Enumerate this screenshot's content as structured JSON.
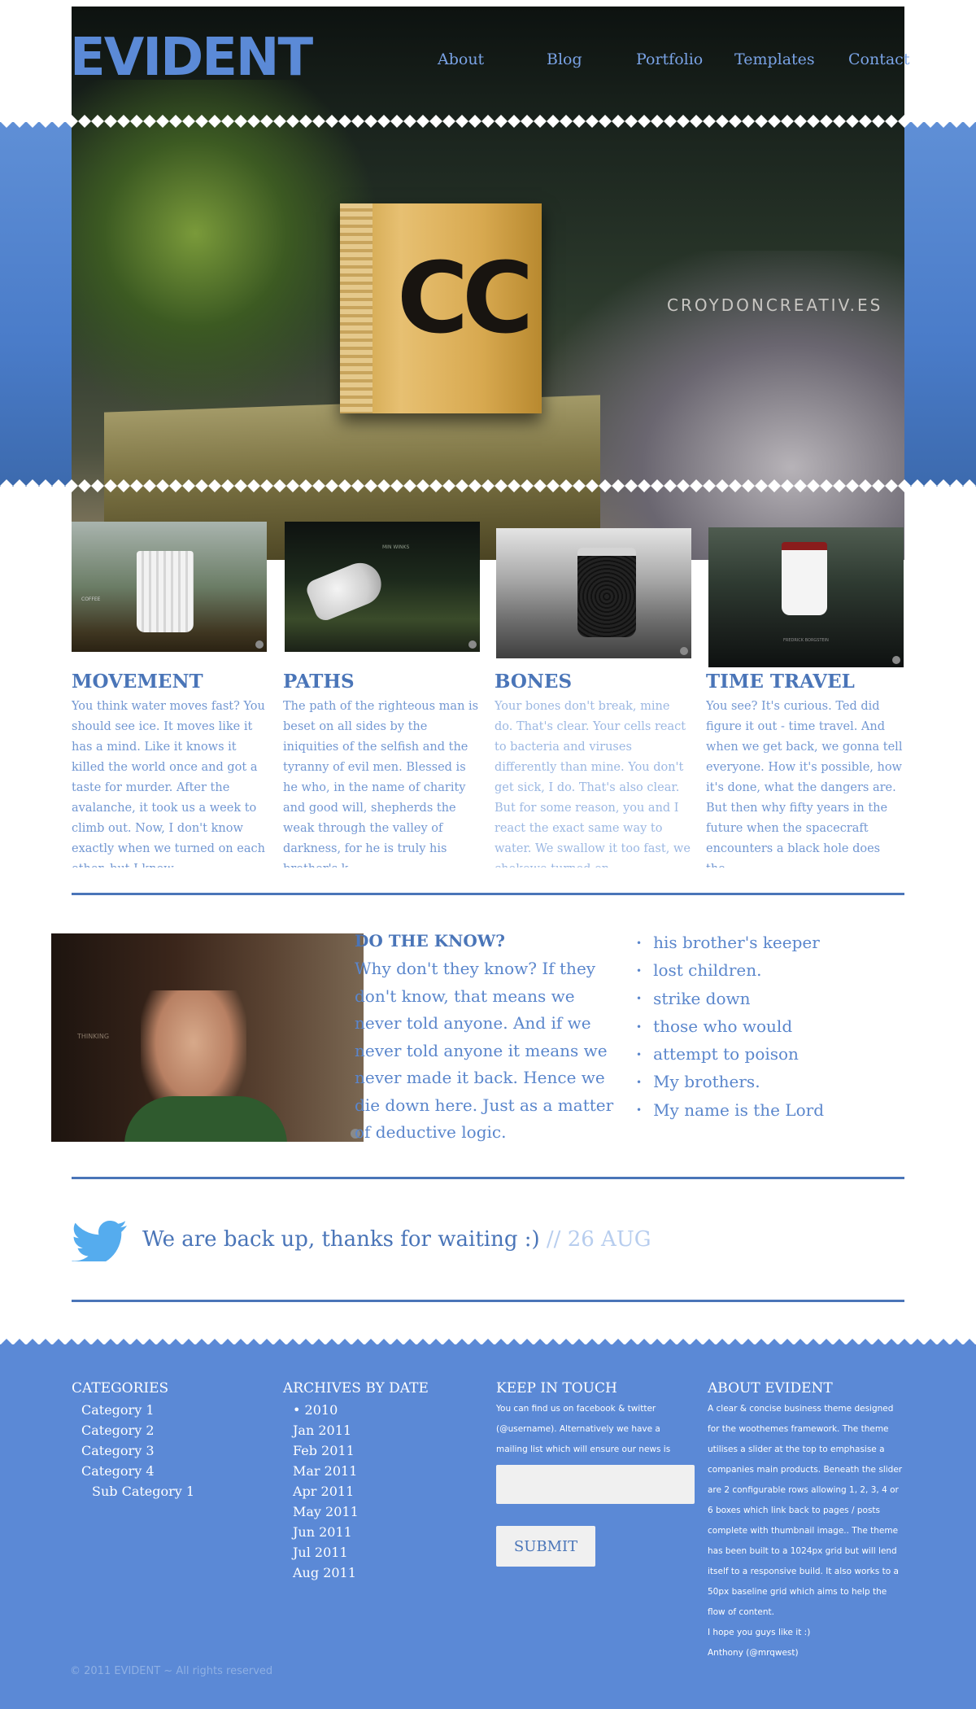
{
  "brand": {
    "logo_text": "EVIDENT",
    "accent": "#5b8ad7",
    "dark_accent": "#4a75b8"
  },
  "nav": {
    "about": "About",
    "blog": "Blog",
    "portfolio": "Portfolio",
    "templates": "Templates",
    "contact": "Contact"
  },
  "hero": {
    "block_text": "CC",
    "watermark": "CROYDONCREATIV.ES"
  },
  "columns": [
    {
      "title": "MOVEMENT",
      "text": "You think water moves fast? You should see ice. It moves like it has a mind. Like it knows it killed the world once and got a taste for murder. After the avalanche, it took us a week to climb out. Now, I don't know exactly when we turned on each other, but I know"
    },
    {
      "title": "PATHS",
      "text": "The path of the righteous man is beset on all sides by the iniquities of the selfish and the tyranny of evil men. Blessed is he who, in the name of charity and good will, shepherds the weak through the valley of darkness, for he is truly his brother's k"
    },
    {
      "title": "BONES",
      "text": "Your bones don't break, mine do. That's clear. Your cells react to bacteria and viruses differently than mine. You don't get sick, I do. That's also clear. But for some reason, you and I react the exact same way to water. We swallow it too fast, we chokewe turned on"
    },
    {
      "title": "TIME TRAVEL",
      "text": "You see? It's curious. Ted did figure it out - time travel. And when we get back, we gonna tell everyone. How it's possible, how it's done, what the dangers are. But then why fifty years in the future when the spacecraft encounters a black hole does the"
    }
  ],
  "thumbs": {
    "thumb1_caption": "COFFEE",
    "thumb2_caption": "MIN WINKS",
    "thumb4_caption": "FREDRICK BORGSTEIN",
    "portrait_caption": "THINKING"
  },
  "know": {
    "title": "DO THE KNOW?",
    "body": "Why don't they know? If they don't know, that means we never told anyone. And if we never told anyone it means we never made it back. Hence we die down here. Just as a matter of deductive logic.",
    "list": [
      "his brother's keeper",
      "lost children.",
      "strike down",
      "those who would",
      "attempt to poison",
      "My brothers.",
      "My name is the Lord"
    ]
  },
  "tweet": {
    "text": "We are back up, thanks for waiting :)",
    "date": "// 26 AUG"
  },
  "footer": {
    "categories_title": "CATEGORIES",
    "categories": [
      "Category 1",
      "Category 2",
      "Category 3",
      "Category 4"
    ],
    "subcategory": "Sub Category 1",
    "archives_title": "ARCHIVES BY DATE",
    "archives_year": "• 2010",
    "archives": [
      "Jan 2011",
      "Feb 2011",
      "Mar 2011",
      "Apr 2011",
      "May 2011",
      "Jun 2011",
      "Jul 2011",
      "Aug 2011"
    ],
    "keep_title": "KEEP IN TOUCH",
    "keep_text": "You can find us on facebook & twitter (@username). Alternatively we have a mailing list which will ensure our news is delivered",
    "email_placeholder": "",
    "submit_label": "SUBMIT",
    "about_title": "ABOUT EVIDENT",
    "about_text": "A clear & concise business theme designed for the woothemes framework. The theme utilises a slider at the top to emphasise a companies main products. Beneath the slider are 2 configurable rows allowing 1, 2, 3, 4 or 6 boxes which link back to pages / posts complete with thumbnail image.. The theme has been built to a 1024px grid but will lend itself to a responsive build. It also works to a 50px baseline grid which aims to help the flow of content.",
    "about_sign1": "I hope you guys like it :)",
    "about_sign2": "Anthony (@mrqwest)",
    "copyright": "© 2011 EVIDENT ~ All rights reserved"
  }
}
